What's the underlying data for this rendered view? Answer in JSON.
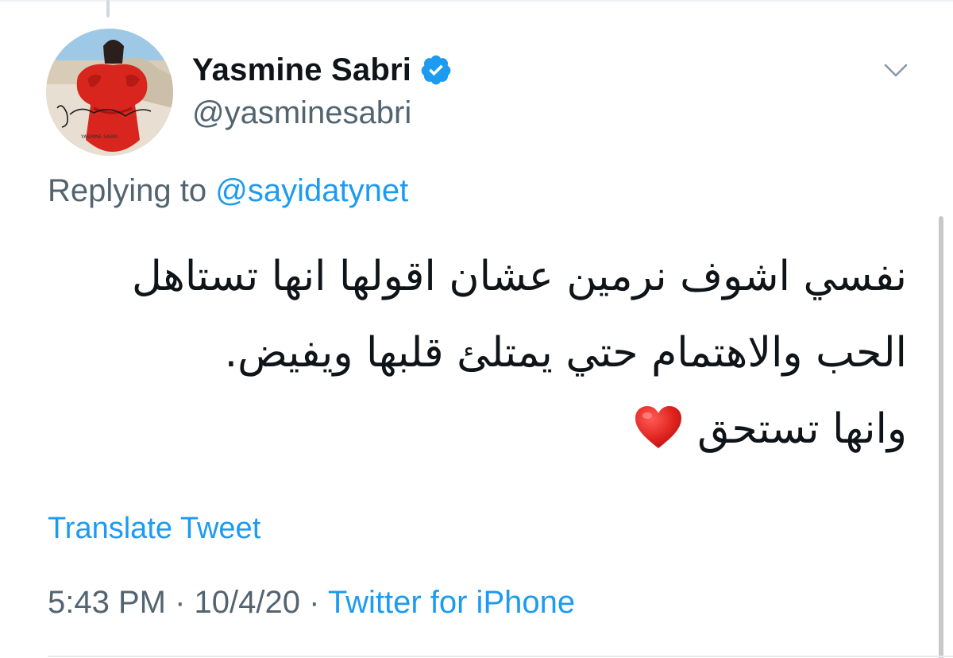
{
  "tweet": {
    "author": {
      "display_name": "Yasmine Sabri",
      "handle": "@yasminesabri",
      "verified": true,
      "avatar_icon": "profile-photo"
    },
    "replying_to": {
      "prefix": "Replying to",
      "mention": "@sayidatynet"
    },
    "text_lines": [
      "نفسي اشوف نرمين عشان اقولها انها تستاهل",
      "الحب والاهتمام حتي يمتلئ قلبها ويفيض.",
      "وانها تستحق"
    ],
    "emoji": "red-heart",
    "translate_label": "Translate Tweet",
    "time": "5:43 PM",
    "date": "10/4/20",
    "separator": "·",
    "source": "Twitter for iPhone"
  },
  "colors": {
    "accent": "#1d9bf0",
    "secondary_text": "#536471",
    "primary_text": "#0f1419",
    "heart": "#d92b2b"
  }
}
